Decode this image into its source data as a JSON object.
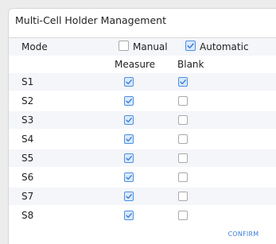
{
  "dialog": {
    "title": "Multi-Cell Holder Management",
    "mode_label": "Mode",
    "mode_options": [
      {
        "label": "Manual",
        "checked": false
      },
      {
        "label": "Automatic",
        "checked": true
      }
    ],
    "columns": [
      "Measure",
      "Blank"
    ],
    "rows": [
      {
        "label": "S1",
        "measure": true,
        "blank": true
      },
      {
        "label": "S2",
        "measure": true,
        "blank": false
      },
      {
        "label": "S3",
        "measure": true,
        "blank": false
      },
      {
        "label": "S4",
        "measure": true,
        "blank": false
      },
      {
        "label": "S5",
        "measure": true,
        "blank": false
      },
      {
        "label": "S6",
        "measure": true,
        "blank": false
      },
      {
        "label": "S7",
        "measure": true,
        "blank": false
      },
      {
        "label": "S8",
        "measure": true,
        "blank": false
      }
    ],
    "confirm_label": "CONFIRM"
  },
  "colors": {
    "accent": "#4a90e2",
    "row_alt": "#f4f6fa"
  }
}
